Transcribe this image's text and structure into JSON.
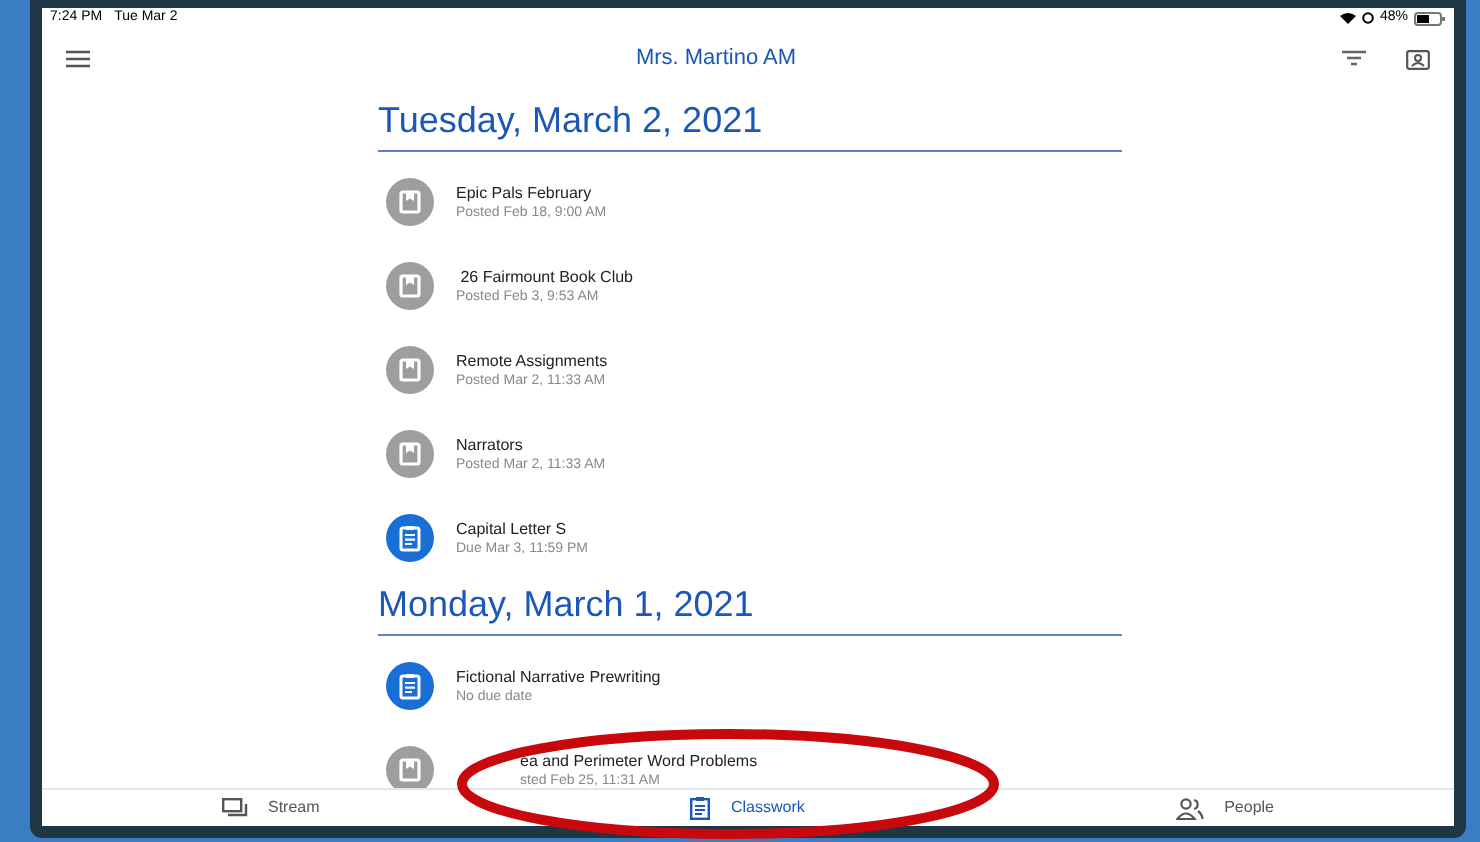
{
  "status_bar": {
    "time": "7:24 PM",
    "date": "Tue Mar 2",
    "battery": "48%"
  },
  "header": {
    "title": "Mrs. Martino AM"
  },
  "sections": [
    {
      "heading": "Tuesday, March 2, 2021",
      "items": [
        {
          "kind": "material",
          "title": "Epic Pals February",
          "subtitle": "Posted Feb 18, 9:00 AM"
        },
        {
          "kind": "material",
          "title": " 26 Fairmount Book Club",
          "subtitle": "Posted Feb 3, 9:53 AM"
        },
        {
          "kind": "material",
          "title": "Remote Assignments",
          "subtitle": "Posted Mar 2, 11:33 AM"
        },
        {
          "kind": "material",
          "title": "Narrators",
          "subtitle": "Posted Mar 2, 11:33 AM"
        },
        {
          "kind": "assignment",
          "title": "Capital Letter S",
          "subtitle": "Due Mar 3, 11:59 PM"
        }
      ]
    },
    {
      "heading": "Monday, March 1, 2021",
      "items": [
        {
          "kind": "assignment",
          "title": "Fictional Narrative Prewriting",
          "subtitle": "No due date"
        },
        {
          "kind": "material",
          "title": "ea and Perimeter Word Problems",
          "subtitle": "sted Feb 25, 11:31 AM"
        }
      ]
    }
  ],
  "bottom_nav": [
    {
      "kind": "stream",
      "label": "Stream",
      "selected": false
    },
    {
      "kind": "classwork",
      "label": "Classwork",
      "selected": true
    },
    {
      "kind": "people",
      "label": "People",
      "selected": false
    }
  ]
}
